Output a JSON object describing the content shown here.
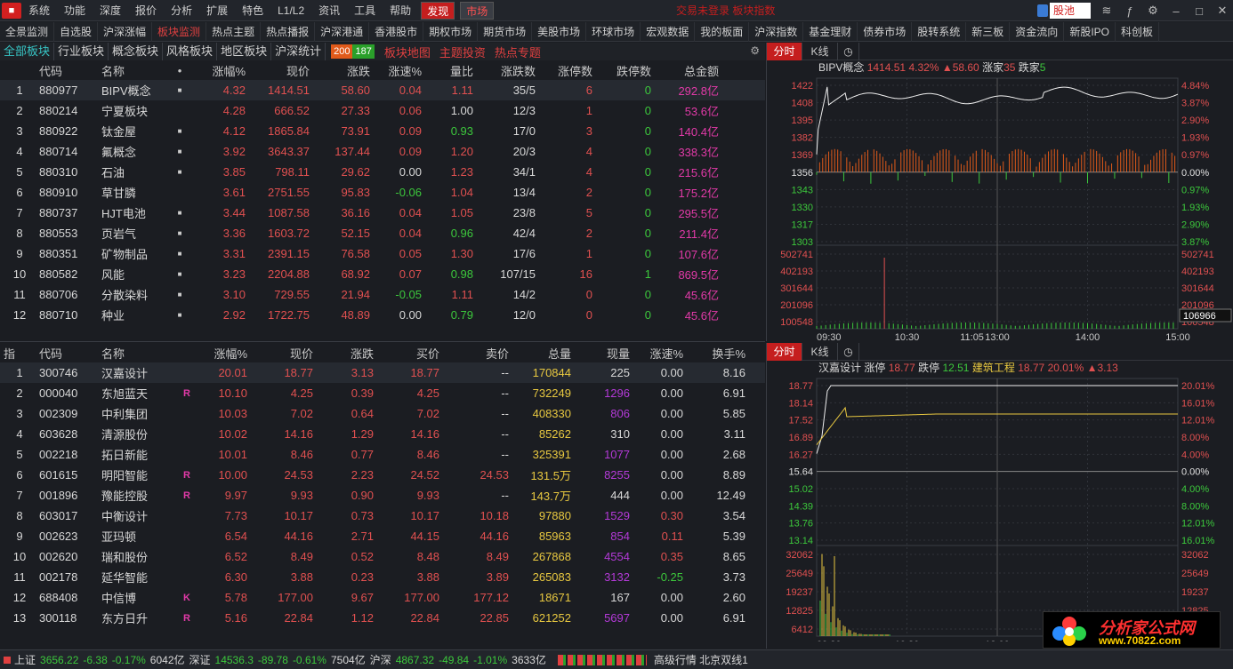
{
  "menu": {
    "items": [
      "系统",
      "功能",
      "深度",
      "报价",
      "分析",
      "扩展",
      "特色",
      "L1/L2",
      "资讯",
      "工具",
      "帮助"
    ],
    "discover": "发现",
    "market": "市场",
    "center_text": "交易未登录   板块指数",
    "search_text": "股池"
  },
  "tabs": [
    "全景监测",
    "自选股",
    "沪深涨幅",
    "板块监测",
    "热点主题",
    "热点播报",
    "沪深港通",
    "香港股市",
    "期权市场",
    "期货市场",
    "美股市场",
    "环球市场",
    "宏观数据",
    "我的板面",
    "沪深指数",
    "基金理财",
    "债券市场",
    "股转系统",
    "新三板",
    "资金流向",
    "新股IPO",
    "科创板"
  ],
  "boardbar": {
    "tabs": [
      "全部板块",
      "行业板块",
      "概念板块",
      "风格板块",
      "地区板块",
      "沪深统计"
    ],
    "up_count": "200",
    "down_count": "187",
    "links": [
      "板块地图",
      "主题投资",
      "热点专题"
    ]
  },
  "board_table": {
    "headers": [
      "代码",
      "名称",
      "涨幅%",
      "现价",
      "涨跌",
      "涨速%",
      "量比",
      "涨跌数",
      "涨停数",
      "跌停数",
      "总金额"
    ],
    "rows": [
      [
        "1",
        "880977",
        "BIPV概念",
        "4.32",
        "1414.51",
        "58.60",
        "0.04",
        "1.11",
        "35/5",
        "6",
        "0",
        "292.8亿"
      ],
      [
        "2",
        "880214",
        "宁夏板块",
        "4.28",
        "666.52",
        "27.33",
        "0.06",
        "1.00",
        "12/3",
        "1",
        "0",
        "53.6亿"
      ],
      [
        "3",
        "880922",
        "钛金屋",
        "4.12",
        "1865.84",
        "73.91",
        "0.09",
        "0.93",
        "17/0",
        "3",
        "0",
        "140.4亿"
      ],
      [
        "4",
        "880714",
        "氟概念",
        "3.92",
        "3643.37",
        "137.44",
        "0.09",
        "1.20",
        "20/3",
        "4",
        "0",
        "338.3亿"
      ],
      [
        "5",
        "880310",
        "石油",
        "3.85",
        "798.11",
        "29.62",
        "0.00",
        "1.23",
        "34/1",
        "4",
        "0",
        "215.6亿"
      ],
      [
        "6",
        "880910",
        "草甘膦",
        "3.61",
        "2751.55",
        "95.83",
        "-0.06",
        "1.04",
        "13/4",
        "2",
        "0",
        "175.2亿"
      ],
      [
        "7",
        "880737",
        "HJT电池",
        "3.44",
        "1087.58",
        "36.16",
        "0.04",
        "1.05",
        "23/8",
        "5",
        "0",
        "295.5亿"
      ],
      [
        "8",
        "880553",
        "页岩气",
        "3.36",
        "1603.72",
        "52.15",
        "0.04",
        "0.96",
        "42/4",
        "2",
        "0",
        "211.4亿"
      ],
      [
        "9",
        "880351",
        "矿物制品",
        "3.31",
        "2391.15",
        "76.58",
        "0.05",
        "1.30",
        "17/6",
        "1",
        "0",
        "107.6亿"
      ],
      [
        "10",
        "880582",
        "风能",
        "3.23",
        "2204.88",
        "68.92",
        "0.07",
        "0.98",
        "107/15",
        "16",
        "1",
        "869.5亿"
      ],
      [
        "11",
        "880706",
        "分散染料",
        "3.10",
        "729.55",
        "21.94",
        "-0.05",
        "1.11",
        "14/2",
        "0",
        "0",
        "45.6亿"
      ],
      [
        "12",
        "880710",
        "种业",
        "2.92",
        "1722.75",
        "48.89",
        "0.00",
        "0.79",
        "12/0",
        "0",
        "0",
        "45.6亿"
      ]
    ]
  },
  "stock_table": {
    "corner": "指",
    "headers": [
      "代码",
      "名称",
      "涨幅%",
      "现价",
      "涨跌",
      "买价",
      "卖价",
      "总量",
      "现量",
      "涨速%",
      "换手%"
    ],
    "rows": [
      [
        "1",
        "300746",
        "汉嘉设计",
        "",
        "20.01",
        "18.77",
        "3.13",
        "18.77",
        "--",
        "170844",
        "225",
        "0.00",
        "8.16"
      ],
      [
        "2",
        "000040",
        "东旭蓝天",
        "R",
        "10.10",
        "4.25",
        "0.39",
        "4.25",
        "--",
        "732249",
        "1296",
        "0.00",
        "6.91"
      ],
      [
        "3",
        "002309",
        "中利集团",
        "",
        "10.03",
        "7.02",
        "0.64",
        "7.02",
        "--",
        "408330",
        "806",
        "0.00",
        "5.85"
      ],
      [
        "4",
        "603628",
        "清源股份",
        "",
        "10.02",
        "14.16",
        "1.29",
        "14.16",
        "--",
        "85262",
        "310",
        "0.00",
        "3.11"
      ],
      [
        "5",
        "002218",
        "拓日新能",
        "",
        "10.01",
        "8.46",
        "0.77",
        "8.46",
        "--",
        "325391",
        "1077",
        "0.00",
        "2.68"
      ],
      [
        "6",
        "601615",
        "明阳智能",
        "R",
        "10.00",
        "24.53",
        "2.23",
        "24.52",
        "24.53",
        "131.5万",
        "8255",
        "0.00",
        "8.89"
      ],
      [
        "7",
        "001896",
        "豫能控股",
        "R",
        "9.97",
        "9.93",
        "0.90",
        "9.93",
        "--",
        "143.7万",
        "444",
        "0.00",
        "12.49"
      ],
      [
        "8",
        "603017",
        "中衡设计",
        "",
        "7.73",
        "10.17",
        "0.73",
        "10.17",
        "10.18",
        "97880",
        "1529",
        "0.30",
        "3.54"
      ],
      [
        "9",
        "002623",
        "亚玛顿",
        "",
        "6.54",
        "44.16",
        "2.71",
        "44.15",
        "44.16",
        "85963",
        "854",
        "0.11",
        "5.39"
      ],
      [
        "10",
        "002620",
        "瑞和股份",
        "",
        "6.52",
        "8.49",
        "0.52",
        "8.48",
        "8.49",
        "267868",
        "4554",
        "0.35",
        "8.65"
      ],
      [
        "11",
        "002178",
        "延华智能",
        "",
        "6.30",
        "3.88",
        "0.23",
        "3.88",
        "3.89",
        "265083",
        "3132",
        "-0.25",
        "3.73"
      ],
      [
        "12",
        "688408",
        "中信博",
        "K",
        "5.78",
        "177.00",
        "9.67",
        "177.00",
        "177.12",
        "18671",
        "167",
        "0.00",
        "2.60"
      ],
      [
        "13",
        "300118",
        "东方日升",
        "R",
        "5.16",
        "22.84",
        "1.12",
        "22.84",
        "22.85",
        "621252",
        "5697",
        "0.00",
        "6.91"
      ]
    ]
  },
  "chart_top": {
    "tabs": [
      "分时",
      "K线"
    ],
    "name": "BIPV概念",
    "price": "1414.51",
    "pct": "4.32%",
    "chg": "▲58.60",
    "up_label": "涨家",
    "up_val": "35",
    "down_label": "跌家",
    "down_val": "5",
    "price_ticks": [
      "1422",
      "1408",
      "1395",
      "1382",
      "1369",
      "1356",
      "1343",
      "1330",
      "1317",
      "1303"
    ],
    "pct_ticks": [
      "4.84%",
      "3.87%",
      "2.90%",
      "1.93%",
      "0.97%",
      "0.00%",
      "0.97%",
      "1.93%",
      "2.90%",
      "3.87%"
    ],
    "vol_ticks": [
      "502741",
      "402193",
      "301644",
      "201096",
      "100548"
    ],
    "vol_readout": "106966",
    "time_ticks": [
      "09:30",
      "10:30",
      "11:05",
      "13:00",
      "14:00",
      "15:00"
    ]
  },
  "chart_bottom": {
    "tabs": [
      "分时",
      "K线"
    ],
    "name": "汉嘉设计",
    "limit_up_label": "涨停",
    "limit_up": "18.77",
    "limit_down_label": "跌停",
    "limit_down": "12.51",
    "sector": "建筑工程",
    "price": "18.77",
    "pct": "20.01%",
    "chg": "▲3.13",
    "price_ticks": [
      "18.77",
      "18.14",
      "17.52",
      "16.89",
      "16.27",
      "15.64",
      "15.02",
      "14.39",
      "13.76",
      "13.14"
    ],
    "pct_ticks": [
      "20.01%",
      "16.01%",
      "12.01%",
      "8.00%",
      "4.00%",
      "0.00%",
      "4.00%",
      "8.00%",
      "12.01%",
      "16.01%"
    ],
    "vol_ticks": [
      "32062",
      "25649",
      "19237",
      "12825",
      "6412"
    ],
    "time_ticks": [
      "09:30",
      "10:30",
      "13:00"
    ]
  },
  "status": {
    "sh_label": "上证",
    "sh_val": "3656.22",
    "sh_chg": "-6.38",
    "sh_pct": "-0.17%",
    "sh_amt": "6042亿",
    "sz_label": "深证",
    "sz_val": "14536.3",
    "sz_chg": "-89.78",
    "sz_pct": "-0.61%",
    "sz_amt": "7504亿",
    "hs_label": "沪深",
    "hs_val": "4867.32",
    "hs_chg": "-49.84",
    "hs_pct": "-1.01%",
    "hs_amt": "3633亿",
    "line": "高级行情 北京双线1"
  },
  "brand": {
    "name": "分析家公式网",
    "url": "www.70822.com"
  }
}
